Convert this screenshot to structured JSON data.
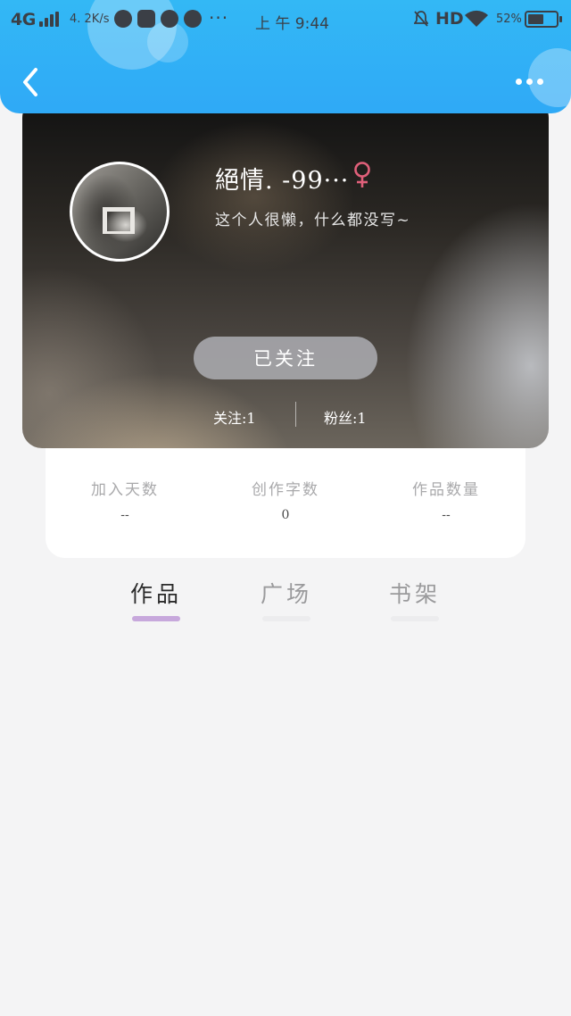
{
  "status_bar": {
    "network": "4G",
    "speed": "4. 2K/s",
    "more": "···",
    "time": "上 午 9:44",
    "hd": "HD",
    "battery": "52%",
    "battery_level": 0.52
  },
  "header": {
    "back_icon": "chevron-left-icon",
    "more_icon": "more-dots-icon"
  },
  "profile": {
    "nickname": "絕情. -99···",
    "gender_symbol": "♀",
    "gender_color": "#e0607a",
    "bio": "这个人很懒，什么都没写~",
    "follow_button": "已关注",
    "following_label": "关注:1",
    "fans_label": "粉丝:1"
  },
  "stats": [
    {
      "label": "加入天数",
      "value": "--"
    },
    {
      "label": "创作字数",
      "value": "0"
    },
    {
      "label": "作品数量",
      "value": "--"
    }
  ],
  "tabs": [
    {
      "label": "作品",
      "active": true
    },
    {
      "label": "广场",
      "active": false
    },
    {
      "label": "书架",
      "active": false
    }
  ],
  "colors": {
    "header_blue": "#33b8f5",
    "tab_indicator": "#c7a8dc",
    "page_background": "#f4f4f5"
  }
}
